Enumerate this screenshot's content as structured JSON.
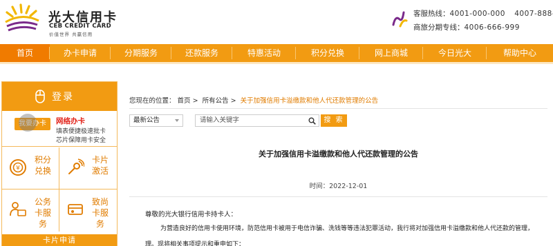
{
  "header": {
    "logo_cn": "光大信用卡",
    "logo_en": "CEB CREDIT CARD",
    "logo_slogan": "价值世界 共赢信用",
    "hotline_label": "客服热线：",
    "hotline_number": "4001-000-000",
    "hotline_number2": "4007-888-",
    "installment_label": "商旅分期专线：",
    "installment_number": "4006-666-999"
  },
  "nav": {
    "items": [
      {
        "label": "首页"
      },
      {
        "label": "办卡申请"
      },
      {
        "label": "分期服务"
      },
      {
        "label": "还款服务"
      },
      {
        "label": "特惠活动"
      },
      {
        "label": "积分兑换"
      },
      {
        "label": "网上商城"
      },
      {
        "label": "今日光大"
      },
      {
        "label": "帮助中心"
      }
    ],
    "active_index": 0
  },
  "sidebar": {
    "login_label": "登录",
    "online": {
      "button": "我要办卡",
      "title": "网络办卡",
      "line1": "填表便捷极速批卡",
      "line2": "芯片保障用卡安全"
    },
    "grid": [
      {
        "label": "积分兑换",
        "icon": "points-icon"
      },
      {
        "label": "卡片激活",
        "icon": "activate-icon"
      },
      {
        "label": "公务卡服务",
        "icon": "business-card-icon"
      },
      {
        "label": "致尚卡服务",
        "icon": "zhishang-card-icon"
      }
    ],
    "card_apply": "卡片申请"
  },
  "main": {
    "breadcrumb": {
      "prefix": "您现在的位置：",
      "items": [
        "首页",
        "所有公告",
        "关于加强信用卡溢缴款和他人代还款管理的公告"
      ]
    },
    "filter": {
      "select_value": "最新公告",
      "search_placeholder": "请输入关键字",
      "search_button": "搜 索"
    },
    "article": {
      "title": "关于加强信用卡溢缴款和他人代还款管理的公告",
      "time": "时间：2022-12-01",
      "greeting": "尊敬的光大银行信用卡持卡人：",
      "para1": "为营造良好的信用卡使用环境，防范信用卡被用于电信诈骗、洗钱等等违法犯罪活动，我行将对加强信用卡溢缴款和他人代还款的管理，",
      "para2": "理。现将相关事项提示和重申如下："
    }
  },
  "colors": {
    "brand_orange": "#f29b12",
    "nav_active": "#f07b00",
    "highlight": "#e07c00",
    "red": "#e2231a"
  }
}
